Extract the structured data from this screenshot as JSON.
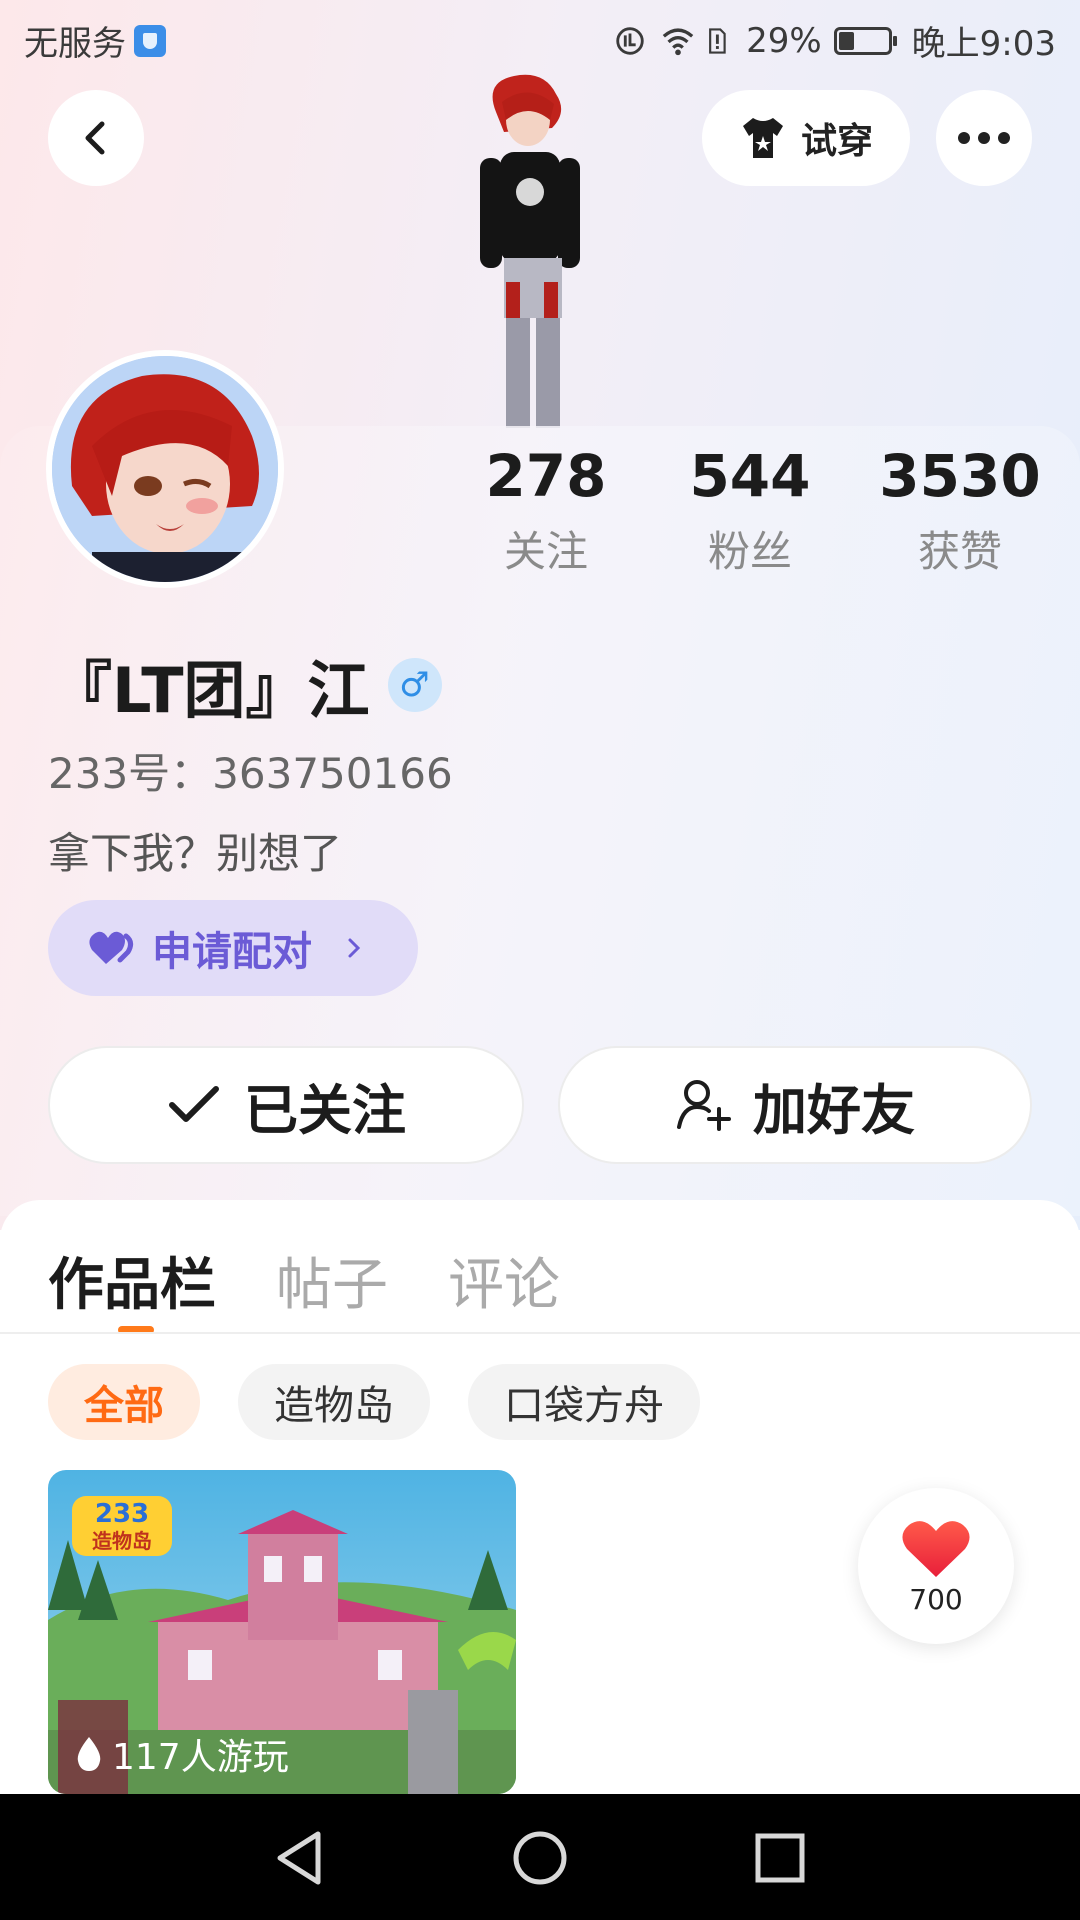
{
  "status_bar": {
    "carrier": "无服务",
    "battery": "29%",
    "time": "晚上9:03"
  },
  "header": {
    "try_on_label": "试穿"
  },
  "profile": {
    "stats": [
      {
        "value": "278",
        "label": "关注"
      },
      {
        "value": "544",
        "label": "粉丝"
      },
      {
        "value": "3530",
        "label": "获赞"
      }
    ],
    "name": "『LT团』江",
    "gender_symbol": "♂",
    "uid": "233号：363750166",
    "bio": "拿下我？别想了",
    "pair_label": "申请配对",
    "follow_label": "已关注",
    "add_friend_label": "加好友"
  },
  "tabs": [
    {
      "label": "作品栏",
      "active": true
    },
    {
      "label": "帖子",
      "active": false
    },
    {
      "label": "评论",
      "active": false
    }
  ],
  "filters": [
    {
      "label": "全部",
      "active": true
    },
    {
      "label": "造物岛",
      "active": false
    },
    {
      "label": "口袋方舟",
      "active": false
    }
  ],
  "works": [
    {
      "logo_number": "233",
      "logo_text": "造物岛",
      "play_count": "117人游玩"
    }
  ],
  "likes": {
    "count": "700"
  },
  "colors": {
    "accent_orange": "#ff6a13",
    "pair_purple": "#6b5bd6",
    "heart_red": "#f23b3b"
  }
}
